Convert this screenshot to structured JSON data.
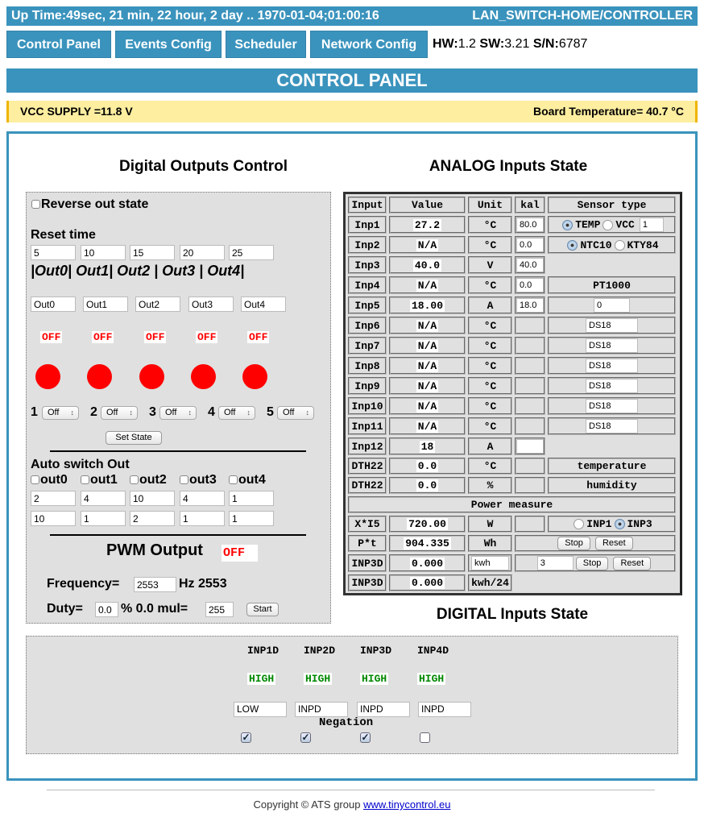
{
  "header": {
    "uptime": "Up Time:49sec, 21 min, 22 hour, 2 day .. 1970-01-04;01:00:16",
    "device": "LAN_SWITCH-HOME/CONTROLLER"
  },
  "nav": {
    "items": [
      "Control Panel",
      "Events Config",
      "Scheduler",
      "Network Config"
    ],
    "hw_label": "HW:",
    "hw": "1.2",
    "sw_label": "SW:",
    "sw": "3.21",
    "sn_label": "S/N:",
    "sn": "6787"
  },
  "title": "CONTROL PANEL",
  "status": {
    "vcc": "VCC SUPPLY =11.8 V",
    "board_temp": "Board Temperature= 40.7 °C"
  },
  "colors": {
    "accent": "#3a93bd",
    "warning_bg": "#fdeea0",
    "off": "#ff0000",
    "high": "#008800"
  },
  "digital_outputs": {
    "title": "Digital Outputs Control",
    "reverse_label": "Reverse out state",
    "reverse_checked": false,
    "reset_time_label": "Reset time",
    "reset_times": [
      "5",
      "10",
      "15",
      "20",
      "25"
    ],
    "out_header": "|Out0| Out1| Out2 | Out3 | Out4|",
    "names": [
      "Out0",
      "Out1",
      "Out2",
      "Out3",
      "Out4"
    ],
    "states": [
      "OFF",
      "OFF",
      "OFF",
      "OFF",
      "OFF"
    ],
    "select_numbers": [
      "1",
      "2",
      "3",
      "4",
      "5"
    ],
    "select_values": [
      "Off",
      "Off",
      "Off",
      "Off",
      "Off"
    ],
    "set_state_label": "Set State",
    "auto_switch_label": "Auto switch Out",
    "auto_outs": [
      "out0",
      "out1",
      "out2",
      "out3",
      "out4"
    ],
    "auto_row1": [
      "2",
      "4",
      "10",
      "4",
      "1"
    ],
    "auto_row2": [
      "10",
      "1",
      "2",
      "1",
      "1"
    ]
  },
  "pwm": {
    "title": "PWM Output",
    "state": "OFF",
    "frequency_label": "Frequency=",
    "frequency": "2553",
    "hz_label": "Hz 2553",
    "duty_label": "Duty=",
    "duty": "0.0",
    "mul_label": "% 0.0 mul=",
    "mul": "255",
    "start_label": "Start"
  },
  "analog": {
    "title": "ANALOG Inputs State",
    "headers": [
      "Input",
      "Value",
      "Unit",
      "kal",
      "Sensor type"
    ],
    "rows": [
      {
        "input": "Inp1",
        "value": "27.2",
        "unit": "°C",
        "kal": "80.0",
        "sensor": {
          "kind": "radio",
          "options": [
            {
              "label": "TEMP",
              "checked": true
            },
            {
              "label": "VCC",
              "checked": false
            }
          ],
          "input": "1"
        }
      },
      {
        "input": "Inp2",
        "value": "N/A",
        "unit": "°C",
        "kal": "0.0",
        "sensor": {
          "kind": "radio",
          "options": [
            {
              "label": "NTC10",
              "checked": true
            },
            {
              "label": "KTY84",
              "checked": false
            }
          ]
        }
      },
      {
        "input": "Inp3",
        "value": "40.0",
        "unit": "V",
        "kal": "40.0",
        "sensor": {
          "kind": "none"
        }
      },
      {
        "input": "Inp4",
        "value": "N/A",
        "unit": "°C",
        "kal": "0.0",
        "sensor": {
          "kind": "text",
          "text": "PT1000"
        }
      },
      {
        "input": "Inp5",
        "value": "18.00",
        "unit": "A",
        "kal": "18.0",
        "sensor": {
          "kind": "input",
          "value": "0"
        }
      },
      {
        "input": "Inp6",
        "value": "N/A",
        "unit": "°C",
        "sensor": {
          "kind": "input",
          "value": "DS18"
        }
      },
      {
        "input": "Inp7",
        "value": "N/A",
        "unit": "°C",
        "sensor": {
          "kind": "input",
          "value": "DS18"
        }
      },
      {
        "input": "Inp8",
        "value": "N/A",
        "unit": "°C",
        "sensor": {
          "kind": "input",
          "value": "DS18"
        }
      },
      {
        "input": "Inp9",
        "value": "N/A",
        "unit": "°C",
        "sensor": {
          "kind": "input",
          "value": "DS18"
        }
      },
      {
        "input": "Inp10",
        "value": "N/A",
        "unit": "°C",
        "sensor": {
          "kind": "input",
          "value": "DS18"
        }
      },
      {
        "input": "Inp11",
        "value": "N/A",
        "unit": "°C",
        "sensor": {
          "kind": "input",
          "value": "DS18"
        }
      },
      {
        "input": "Inp12",
        "value": "18",
        "unit": "A",
        "kal": "",
        "sensor": {
          "kind": "none"
        }
      },
      {
        "input": "DTH22",
        "value": "0.0",
        "unit": "°C",
        "sensor": {
          "kind": "text",
          "text": "temperature"
        }
      },
      {
        "input": "DTH22",
        "value": "0.0",
        "unit": "%",
        "sensor": {
          "kind": "text",
          "text": "humidity"
        }
      }
    ],
    "power_label": "Power measure",
    "power_rows": [
      {
        "input": "X*I5",
        "value": "720.00",
        "unit": "W",
        "options": [
          {
            "label": "INP1",
            "checked": false
          },
          {
            "label": "INP3",
            "checked": true
          }
        ]
      },
      {
        "input": "P*t",
        "value": "904.335",
        "unit": "Wh",
        "stop": "Stop",
        "reset": "Reset"
      },
      {
        "input": "INP3D",
        "value": "0.000",
        "unit_input": "kwh",
        "count": "3",
        "stop": "Stop",
        "reset": "Reset"
      },
      {
        "input": "INP3D",
        "value": "0.000",
        "unit": "kwh/24"
      }
    ]
  },
  "digital_inputs": {
    "title": "DIGITAL Inputs State",
    "items": [
      {
        "name": "INP1D",
        "state": "HIGH",
        "label": "LOW",
        "negation": true
      },
      {
        "name": "INP2D",
        "state": "HIGH",
        "label": "INPD",
        "negation": true
      },
      {
        "name": "INP3D",
        "state": "HIGH",
        "label": "INPD",
        "negation": true
      },
      {
        "name": "INP4D",
        "state": "HIGH",
        "label": "INPD",
        "negation": false
      }
    ],
    "negation_label": "Negation"
  },
  "footer": {
    "text": "Copyright © ATS group ",
    "link": "www.tinycontrol.eu"
  }
}
